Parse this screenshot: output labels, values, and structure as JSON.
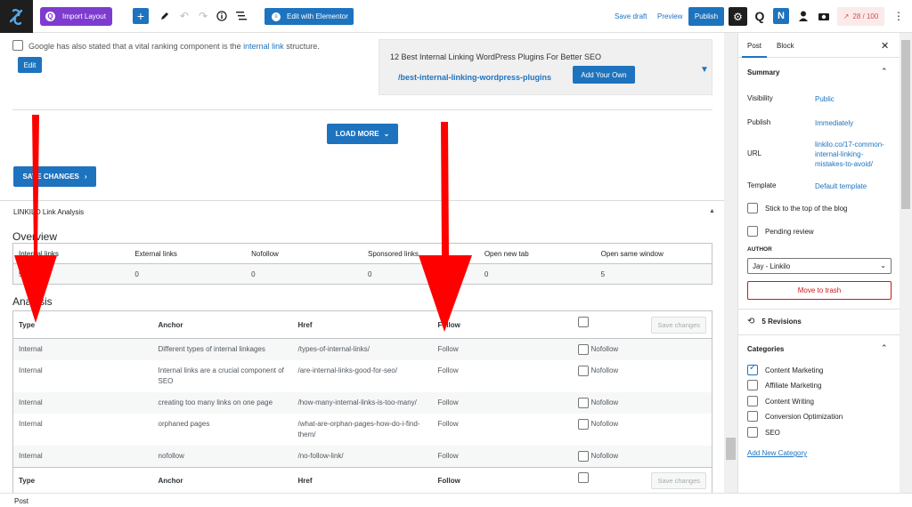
{
  "toolbar": {
    "import_layout_label": "Import Layout",
    "edit_elementor_label": "Edit with Elementor",
    "save_draft_label": "Save draft",
    "preview_label": "Preview",
    "publish_label": "Publish",
    "yoast_score": "28 / 100"
  },
  "suggestion": {
    "text_before": "Google has also stated that a vital ranking component is the ",
    "link_text": "internal link",
    "text_after": " structure.",
    "edit_label": "Edit"
  },
  "target": {
    "title": "12 Best Internal Linking WordPress Plugins For Better SEO",
    "url": "/best-internal-linking-wordpress-plugins",
    "add_own_label": "Add Your Own"
  },
  "load_more_label": "LOAD MORE",
  "save_changes_label": "SAVE CHANGES",
  "panel_title": "LINKILO Link Analysis",
  "overview": {
    "title": "Overview",
    "headers": [
      "Internal links",
      "External links",
      "Nofollow",
      "Sponsored links",
      "Open new tab",
      "Open same window"
    ],
    "values": [
      "5",
      "0",
      "0",
      "0",
      "0",
      "5"
    ]
  },
  "analysis": {
    "title": "Analysis",
    "headers": {
      "type": "Type",
      "anchor": "Anchor",
      "href": "Href",
      "follow": "Follow"
    },
    "save_changes_label": "Save changes",
    "nofollow_label": "Nofollow",
    "rows": [
      {
        "type": "Internal",
        "anchor": "Different types of internal linkages",
        "href": "/types-of-internal-links/",
        "follow": "Follow"
      },
      {
        "type": "Internal",
        "anchor": "Internal links are a crucial component of SEO",
        "href": "/are-internal-links-good-for-seo/",
        "follow": "Follow"
      },
      {
        "type": "Internal",
        "anchor": "creating too many links on one page",
        "href": "/how-many-internal-links-is-too-many/",
        "follow": "Follow"
      },
      {
        "type": "Internal",
        "anchor": "orphaned pages",
        "href": "/what-are-orphan-pages-how-do-i-find-them/",
        "follow": "Follow"
      },
      {
        "type": "Internal",
        "anchor": "nofollow",
        "href": "/no-follow-link/",
        "follow": "Follow"
      }
    ]
  },
  "status_bar": "Post",
  "sidebar": {
    "tab_post": "Post",
    "tab_block": "Block",
    "summary_title": "Summary",
    "visibility_label": "Visibility",
    "visibility_value": "Public",
    "publish_label": "Publish",
    "publish_value": "Immediately",
    "url_label": "URL",
    "url_value": "linkilo.co/17-common-internal-linking-mistakes-to-avoid/",
    "template_label": "Template",
    "template_value": "Default template",
    "stick_label": "Stick to the top of the blog",
    "pending_label": "Pending review",
    "author_label": "AUTHOR",
    "author_value": "Jay - Linkilo",
    "trash_label": "Move to trash",
    "revisions_label": "5 Revisions",
    "categories_title": "Categories",
    "categories": [
      {
        "label": "Content Marketing",
        "checked": true
      },
      {
        "label": "Affiliate Marketing",
        "checked": false
      },
      {
        "label": "Content Writing",
        "checked": false
      },
      {
        "label": "Conversion Optimization",
        "checked": false
      },
      {
        "label": "SEO",
        "checked": false
      }
    ],
    "add_category_label": "Add New Category"
  },
  "colors": {
    "accent": "#1e73be",
    "arrow": "#ff0000",
    "import": "#7e3bd0",
    "danger": "#cc1818"
  }
}
